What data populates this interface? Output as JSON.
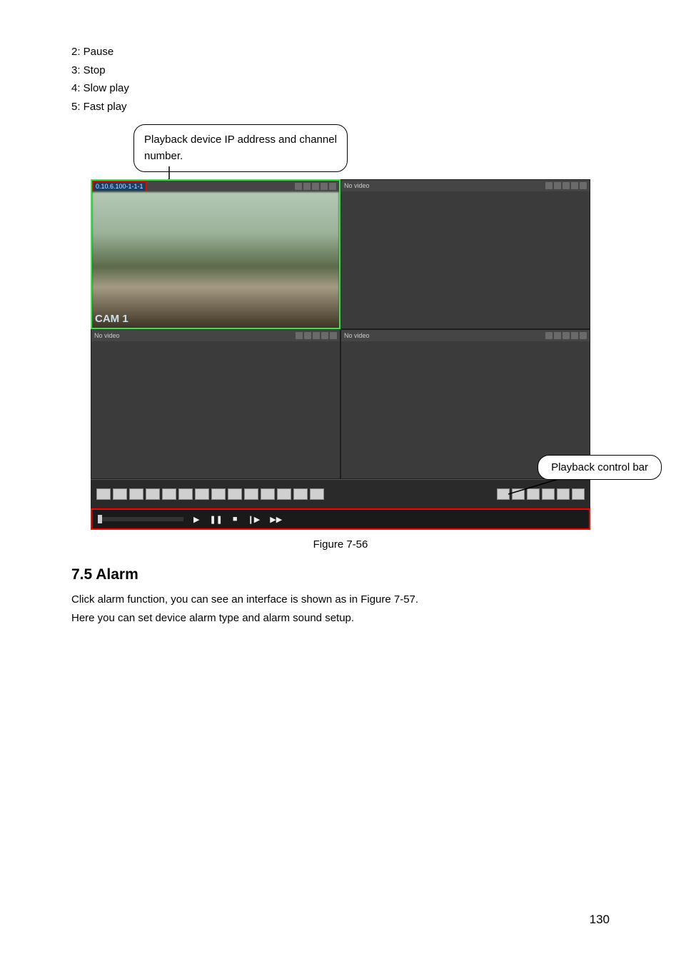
{
  "legend": {
    "l2": "2: Pause",
    "l3": "3: Stop",
    "l4": "4: Slow play",
    "l5": "5: Fast play"
  },
  "callout_top": "Playback device IP address and channel number.",
  "callout_right": "Playback control bar",
  "cells": {
    "ip_label": "0.10.6.100-1-1-1",
    "no_video": "No video",
    "cam_label": "CAM 1"
  },
  "figure_caption": "Figure 7-56",
  "section_heading": "7.5  Alarm",
  "paragraph1": "Click alarm function, you can see an interface is shown as in Figure 7-57.",
  "paragraph2": "Here you can set device alarm type and alarm sound setup.",
  "page_number": "130",
  "playback_icons": {
    "play": "▶",
    "pause": "❚❚",
    "stop": "■",
    "slow": "❙▶",
    "fast": "▶▶"
  }
}
